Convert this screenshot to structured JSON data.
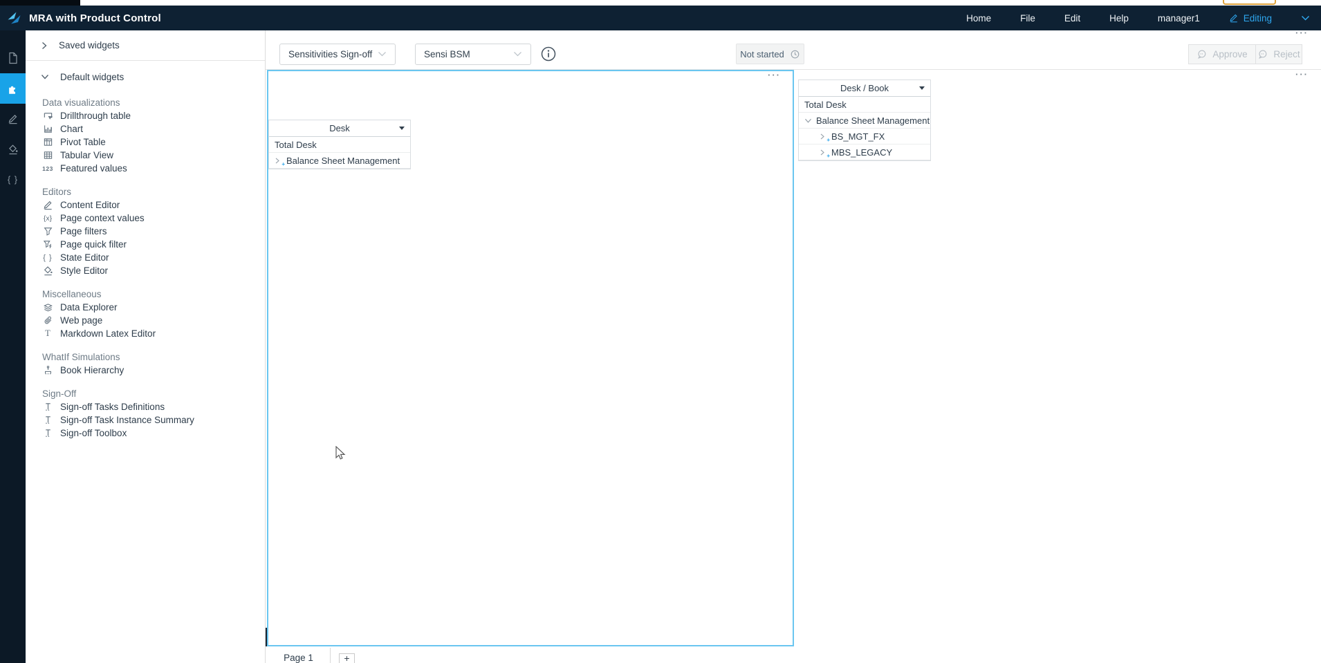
{
  "app_bar": {
    "title": "MRA with Product Control",
    "menu": [
      {
        "label": "Home"
      },
      {
        "label": "File"
      },
      {
        "label": "Edit"
      },
      {
        "label": "Help"
      }
    ],
    "user": "manager1",
    "mode_label": "Editing"
  },
  "rail": {
    "active_index": 1,
    "items": [
      {
        "icon": "file-icon"
      },
      {
        "icon": "widgets-puzzle-icon"
      },
      {
        "icon": "content-editor-pencil-icon"
      },
      {
        "icon": "style-editor-bucket-icon"
      },
      {
        "icon": "state-editor-braces-icon"
      }
    ]
  },
  "widgets_panel": {
    "saved_header": "Saved widgets",
    "default_header": "Default widgets",
    "sections": [
      {
        "title": "Data visualizations",
        "items": [
          {
            "icon": "drillthrough-table-icon",
            "label": "Drillthrough table"
          },
          {
            "icon": "chart-icon",
            "label": "Chart"
          },
          {
            "icon": "pivot-table-icon",
            "label": "Pivot Table"
          },
          {
            "icon": "tabular-view-icon",
            "label": "Tabular View"
          },
          {
            "icon": "featured-values-icon",
            "label": "Featured values"
          }
        ]
      },
      {
        "title": "Editors",
        "items": [
          {
            "icon": "content-editor-pencil-icon",
            "label": "Content Editor"
          },
          {
            "icon": "page-context-values-icon",
            "label": "Page context values"
          },
          {
            "icon": "page-filters-funnel-icon",
            "label": "Page filters"
          },
          {
            "icon": "page-quick-filter-icon",
            "label": "Page quick filter"
          },
          {
            "icon": "state-editor-braces-icon",
            "label": "State Editor"
          },
          {
            "icon": "style-editor-bucket-icon",
            "label": "Style Editor"
          }
        ]
      },
      {
        "title": "Miscellaneous",
        "items": [
          {
            "icon": "data-explorer-layers-icon",
            "label": "Data Explorer"
          },
          {
            "icon": "web-page-link-icon",
            "label": "Web page"
          },
          {
            "icon": "markdown-latex-icon",
            "label": "Markdown Latex Editor"
          }
        ]
      },
      {
        "title": "WhatIf Simulations",
        "items": [
          {
            "icon": "book-hierarchy-icon",
            "label": "Book Hierarchy"
          }
        ]
      },
      {
        "title": "Sign-Off",
        "items": [
          {
            "icon": "signoff-ibeam-icon",
            "label": "Sign-off Tasks Definitions"
          },
          {
            "icon": "signoff-ibeam-icon",
            "label": "Sign-off Task Instance Summary"
          },
          {
            "icon": "signoff-ibeam-icon",
            "label": "Sign-off Toolbox"
          }
        ]
      }
    ]
  },
  "toolbar": {
    "task_select": {
      "value": "Sensitivities Sign-off"
    },
    "subtask_select": {
      "value": "Sensi BSM"
    },
    "status_button": {
      "label": "Not started",
      "icon": "clock-icon"
    },
    "approve_label": "Approve",
    "reject_label": "Reject"
  },
  "canvas": {
    "desk_widget": {
      "header": "Desk",
      "rows": [
        {
          "label": "Total Desk",
          "expander": "none",
          "level": 0
        },
        {
          "label": "Balance Sheet Management",
          "expander": "collapsed",
          "level": 0
        }
      ]
    },
    "desk_book_widget": {
      "header": "Desk / Book",
      "rows": [
        {
          "label": "Total Desk",
          "expander": "none",
          "level": 0
        },
        {
          "label": "Balance Sheet Management",
          "expander": "expanded",
          "level": 0
        },
        {
          "label": "BS_MGT_FX",
          "expander": "collapsed",
          "level": 1
        },
        {
          "label": "MBS_LEGACY",
          "expander": "collapsed",
          "level": 1
        }
      ]
    }
  },
  "page_tabs": {
    "tabs": [
      {
        "label": "Page 1",
        "active": true
      }
    ],
    "add_label": "+"
  },
  "colors": {
    "appbar_navy": "#0e2133",
    "rail_navy": "#0c1926",
    "accent_blue": "#19a3e8",
    "editing_blue": "#2ea6ee",
    "selection_border": "#6ac6f0",
    "text_dark": "#2e3d4b",
    "text_gray": "#6e7b86",
    "disabled_text": "#b8bfc6",
    "orange_sliver": "#dfa43e"
  }
}
